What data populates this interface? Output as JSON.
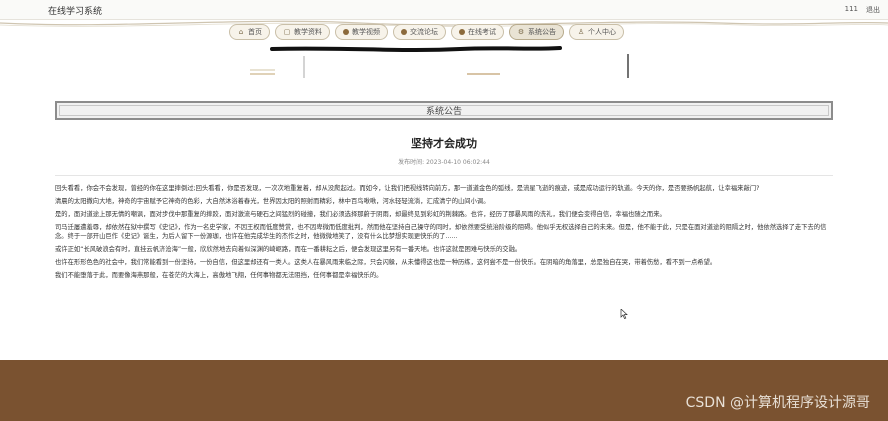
{
  "header": {
    "app_title": "在线学习系统",
    "user": "111",
    "logout_label": "退出"
  },
  "nav": {
    "items": [
      {
        "label": "首页",
        "icon": "home-icon"
      },
      {
        "label": "教学资料",
        "icon": "document-icon"
      },
      {
        "label": "教学视频",
        "icon": "video-icon"
      },
      {
        "label": "交流论坛",
        "icon": "forum-icon"
      },
      {
        "label": "在线考试",
        "icon": "exam-icon"
      },
      {
        "label": "系统公告",
        "icon": "gear-icon",
        "active": true
      },
      {
        "label": "个人中心",
        "icon": "user-icon"
      }
    ]
  },
  "section": {
    "title": "系统公告"
  },
  "article": {
    "title": "坚持才会成功",
    "publish_label": "发布时间:",
    "publish_time": "2023-04-10 06:02:44",
    "paragraphs": [
      "回头看看，你会不会发现，曾经的你在这里摔倒过;回头看看，你是否发现，一次次地重复着，却从没爬起过。而如今，让我们把视线转向前方，那一道道金色的弧线，是流星飞逝的痕迹，或是成功运行的轨道。今天的你，是否要扬帆起航，让幸福来敲门?",
      "清晨的太阳撒向大地，神奇的宇宙赋予它神奇的色彩，大自然沐浴着春光，世界因太阳的照射而精彩，林中百鸟啾啾，河水轻轻流淌，汇成清宁的山间小调。",
      "是的，面对道途上那无情的嘲讽，面对步伐中那重复的摔跤，面对激流与硬石之间猛烈的碰撞，我们必须选择那蔚于阴雨，却最终见到彩虹的荆棘路。也许，经历了那暴风雨的洗礼，我们便会变得自信，幸福也随之而来。",
      "司马迁屡遭羞辱，却依然在狱中撰写《史记》，作为一名史学家，不因王权而低度赞赏，也不因卑微而低度批判，然而他在坚持自己操守的同时，却依然要受统治阶级的阻碍。他似乎无权选择自己的未来。但是，他不能于此，只是在面对道途的阻隔之时，他依然选择了走下去的信念。终于一部开山巨作《史记》诞生，为后人留下一份源珈，也许在他完成华生的杰作之时，他微微地笑了，没有什么比梦想实现更快乐的了......",
      "或许正如“长风破浪会有时，直挂云帆济沧海”一般，欣欣然地去向着似深渊的崎岖路，而在一番耕耘之后，便会发现这里另有一番天地。也许这就是困难与快乐的交融。",
      "也许在形形色色的社会中，我们常能看到一份坚持，一份自信，但这里却还有一类人。这类人在暴风雨来临之际，只会闪躲，从未懂得这也是一种历练，这何尝不是一份快乐。在阴暗的角落里，总是独自在哭，带着伤愁，看不到一点希望。",
      "我们不能堕落于此，而要像海燕那般，在苍茫的大海上，高傲地飞翔，任何事物都无法阻挡，任何事都是幸福快乐的。"
    ]
  },
  "footer": {
    "watermark": "CSDN @计算机程序设计源哥"
  },
  "colors": {
    "footer": "#7a5230",
    "nav_border": "#c9bfa8"
  }
}
